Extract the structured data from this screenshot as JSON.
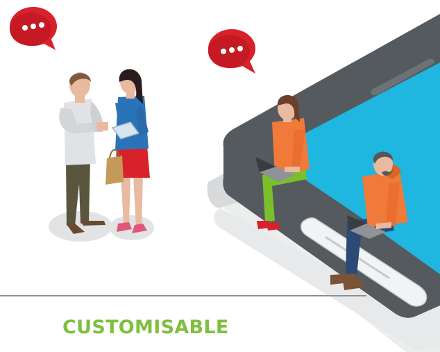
{
  "caption": {
    "text": "CUSTOMISABLE"
  },
  "colors": {
    "caption": "#7fbf3f",
    "bubble": "#d8212b",
    "bubble_dark": "#a9131c",
    "phone_body": "#555a5f",
    "phone_screen": "#1fb6e0",
    "phone_side": "#e6e7e8",
    "shadow": "#e2e3e4",
    "skin": "#e9b9a0"
  },
  "icons": [
    "chat-bubble-icon",
    "chat-bubble-icon"
  ],
  "figures": [
    "man-arms-crossed",
    "woman-with-tablet",
    "woman-with-laptop",
    "man-with-laptop"
  ]
}
